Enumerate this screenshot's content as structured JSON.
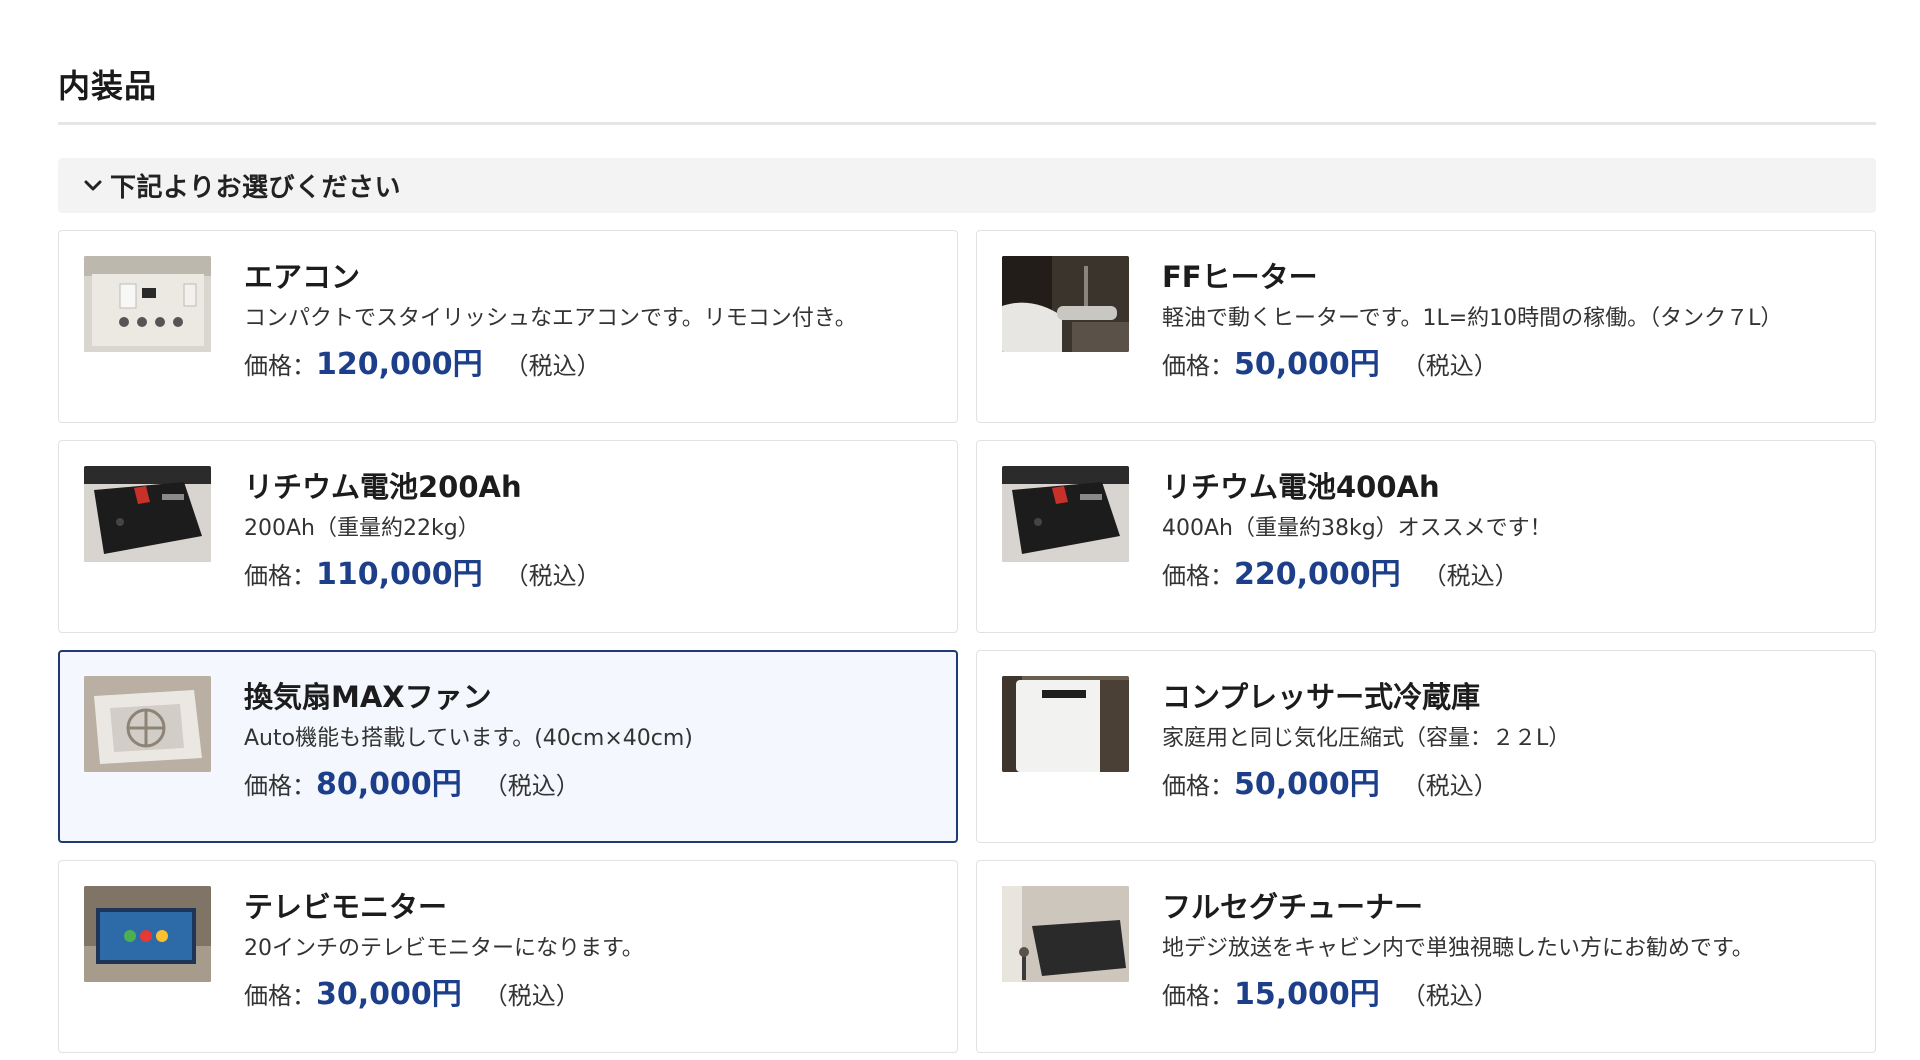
{
  "section": {
    "title": "内装品",
    "selector_label": "下記よりお選びください"
  },
  "price_label": "価格：",
  "tax_label": "（税込）",
  "items": [
    {
      "name": "エアコン",
      "description": "コンパクトでスタイリッシュなエアコンです。リモコン付き。",
      "price": "120,000円",
      "image": "aircon-photo",
      "selected": false
    },
    {
      "name": "FFヒーター",
      "description": "軽油で動くヒーターです。1L=約10時間の稼働。（タンク７L）",
      "price": "50,000円",
      "image": "ff-heater-photo",
      "selected": false
    },
    {
      "name": "リチウム電池200Ah",
      "description": "200Ah（重量約22kg）",
      "price": "110,000円",
      "image": "battery-photo",
      "selected": false
    },
    {
      "name": "リチウム電池400Ah",
      "description": "400Ah（重量約38kg）オススメです！",
      "price": "220,000円",
      "image": "battery-photo",
      "selected": false
    },
    {
      "name": "換気扇MAXファン",
      "description": "Auto機能も搭載しています。(40cm×40cm)",
      "price": "80,000円",
      "image": "vent-fan-photo",
      "selected": true
    },
    {
      "name": "コンプレッサー式冷蔵庫",
      "description": "家庭用と同じ気化圧縮式（容量：２２L）",
      "price": "50,000円",
      "image": "fridge-photo",
      "selected": false
    },
    {
      "name": "テレビモニター",
      "description": "20インチのテレビモニターになります。",
      "price": "30,000円",
      "image": "tv-monitor-photo",
      "selected": false
    },
    {
      "name": "フルセグチューナー",
      "description": "地デジ放送をキャビン内で単独視聴したい方にお勧めです。",
      "price": "15,000円",
      "image": "tuner-photo",
      "selected": false
    }
  ],
  "colors": {
    "price": "#1d3f8a",
    "selected_border": "#1f3a73",
    "selected_background": "#f4f7fd",
    "selector_background": "#f3f3f3"
  }
}
